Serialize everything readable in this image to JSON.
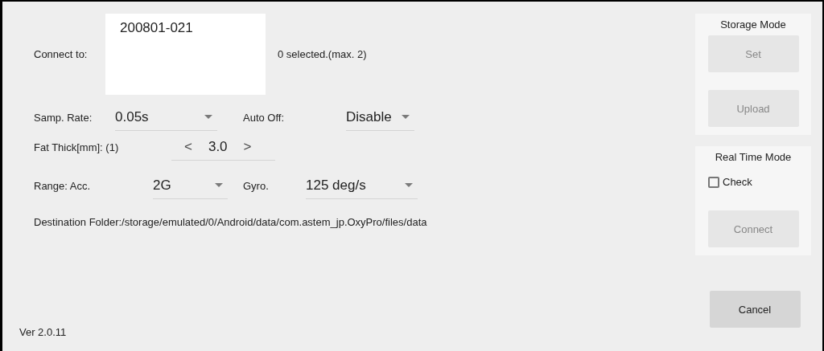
{
  "connect": {
    "label": "Connect to:",
    "devices": [
      "200801-021"
    ],
    "selection_note": "0 selected.(max. 2)"
  },
  "samp_rate": {
    "label": "Samp. Rate:",
    "value": "0.05s"
  },
  "auto_off": {
    "label": "Auto Off:",
    "value": "Disable"
  },
  "fat_thick": {
    "label": "Fat Thick[mm]: (1)",
    "prev": "<",
    "value": "3.0",
    "next": ">"
  },
  "range": {
    "label": "Range: Acc.",
    "value": "2G"
  },
  "gyro": {
    "label": "Gyro.",
    "value": "125 deg/s"
  },
  "destination": "Destination Folder:/storage/emulated/0/Android/data/com.astem_jp.OxyPro/files/data",
  "version": "Ver 2.0.11",
  "storage_mode": {
    "title": "Storage Mode",
    "buttons": [
      {
        "label": "Set",
        "disabled": true
      },
      {
        "label": "Upload",
        "disabled": true
      }
    ]
  },
  "real_time_mode": {
    "title": "Real Time Mode",
    "check": {
      "label": "Check",
      "checked": false
    },
    "button": {
      "label": "Connect",
      "disabled": true
    }
  },
  "cancel": {
    "label": "Cancel",
    "disabled": false
  }
}
